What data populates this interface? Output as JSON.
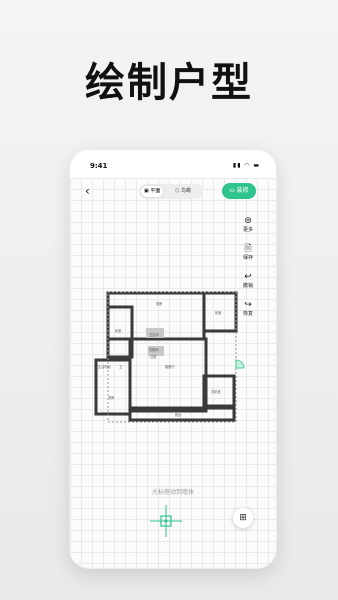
{
  "headline": "绘制户型",
  "status_bar": {
    "time": "9:41",
    "icons": "▮▮ ◠ ▬"
  },
  "toolbar": {
    "back_icon": "‹",
    "view_modes": [
      {
        "label": "平面",
        "icon": "plan-icon",
        "active": true
      },
      {
        "label": "鸟瞰",
        "icon": "cube-icon",
        "active": false
      }
    ],
    "decorate_label": "装修",
    "accent_color": "#2fc38d"
  },
  "side_tools": [
    {
      "label": "更多",
      "icon": "more-icon"
    },
    {
      "label": "保存",
      "icon": "save-icon"
    },
    {
      "label": "撤销",
      "icon": "undo-icon"
    },
    {
      "label": "恢复",
      "icon": "redo-icon"
    }
  ],
  "floorplan": {
    "rooms": [
      "厨房",
      "卧室",
      "卫生间",
      "客餐厅",
      "卧室",
      "次卧室",
      "阳台",
      "衣帽间",
      "过道",
      "书房",
      "生活阳台",
      "卫"
    ]
  },
  "hint": "光标拖动到墙体"
}
